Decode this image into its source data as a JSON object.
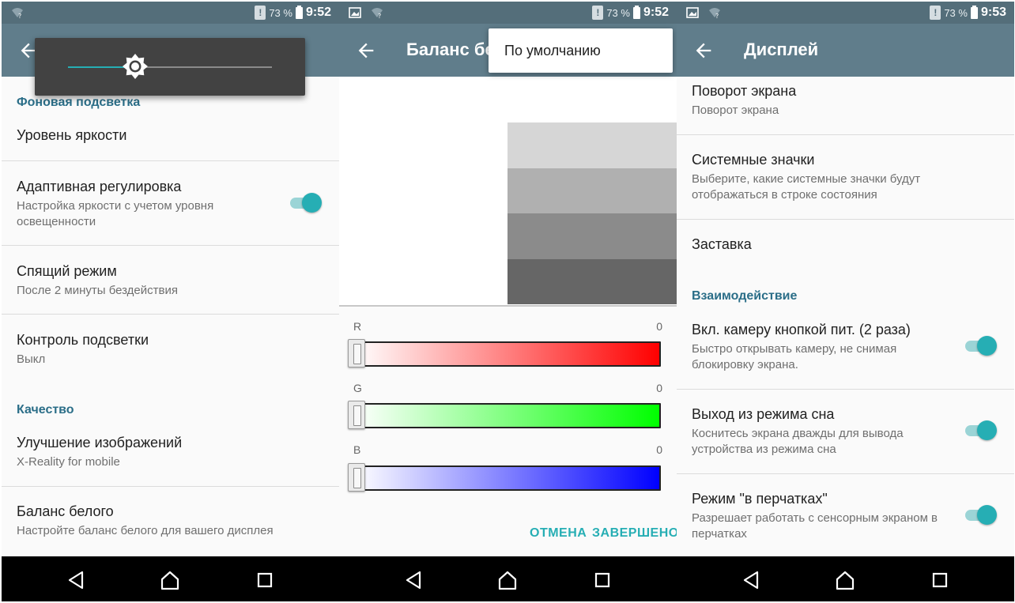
{
  "status_bar": {
    "battery": "73 %",
    "times": [
      "9:52",
      "9:52",
      "9:53"
    ]
  },
  "panel1": {
    "brightness_level": 0.33,
    "sections": {
      "backlight": "Фоновая подсветка",
      "quality": "Качество"
    },
    "items": [
      {
        "title": "Уровень яркости",
        "subtitle": ""
      },
      {
        "title": "Адаптивная регулировка",
        "subtitle": "Настройка яркости с учетом уровня освещенности",
        "toggle": true
      },
      {
        "title": "Спящий режим",
        "subtitle": "После 2 минуты бездействия"
      },
      {
        "title": "Контроль подсветки",
        "subtitle": "Выкл"
      },
      {
        "title": "Улучшение изображений",
        "subtitle": "X-Reality for mobile"
      },
      {
        "title": "Баланс белого",
        "subtitle": "Настройте баланс белого для вашего дисплея"
      }
    ]
  },
  "panel2": {
    "title": "Баланс бе",
    "overflow_menu": {
      "item": "По умолчанию"
    },
    "preview_colors": [
      "#d6d6d6",
      "#b0b0b0",
      "#8b8b8b",
      "#666666"
    ],
    "sliders": [
      {
        "label": "R",
        "value": "0",
        "color": "#ff0000"
      },
      {
        "label": "G",
        "value": "0",
        "color": "#00ff00"
      },
      {
        "label": "B",
        "value": "0",
        "color": "#0000ff"
      }
    ],
    "buttons": {
      "cancel": "ОТМЕНА",
      "done": "ЗАВЕРШЕНО"
    }
  },
  "panel3": {
    "title": "Дисплей",
    "sections": {
      "interaction": "Взаимодействие"
    },
    "items": [
      {
        "title": "Поворот экрана",
        "subtitle": "Поворот экрана"
      },
      {
        "title": "Системные значки",
        "subtitle": "Выберите, какие системные значки будут отображаться в строке состояния"
      },
      {
        "title": "Заставка",
        "subtitle": ""
      },
      {
        "title": "Вкл. камеру кнопкой пит. (2 раза)",
        "subtitle": "Быстро открывать камеру, не снимая блокировку экрана.",
        "toggle": true
      },
      {
        "title": "Выход из режима сна",
        "subtitle": "Коснитесь экрана дважды для вывода устройства из режима сна",
        "toggle": true
      },
      {
        "title": "Режим \"в перчатках\"",
        "subtitle": "Разрешает работать с сенсорным экраном в перчатках",
        "toggle": true
      }
    ]
  },
  "colors": {
    "accent": "#26aeb4",
    "toolbar": "#607d8b",
    "status_bar": "#546e7a",
    "section_header": "#2b6e88"
  }
}
